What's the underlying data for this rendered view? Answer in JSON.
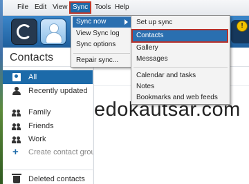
{
  "menubar": {
    "items": [
      "File",
      "Edit",
      "View",
      "Sync",
      "Tools",
      "Help"
    ],
    "active": "Sync"
  },
  "toolbar": {
    "warning_badge": "!"
  },
  "sidebar": {
    "title": "Contacts",
    "items": [
      {
        "label": "All",
        "icon": "all-contacts-icon",
        "selected": true
      },
      {
        "label": "Recently updated",
        "icon": "recent-icon"
      },
      {
        "label": "Family",
        "icon": "group-icon"
      },
      {
        "label": "Friends",
        "icon": "group-icon"
      },
      {
        "label": "Work",
        "icon": "group-icon"
      },
      {
        "label": "Create contact group",
        "icon": "plus-icon"
      },
      {
        "label": "Deleted contacts",
        "icon": "trash-icon"
      }
    ]
  },
  "sync_menu": {
    "items": [
      "Sync now",
      "View Sync log",
      "Sync options",
      "Repair sync..."
    ]
  },
  "sync_now_submenu": {
    "items": [
      "Set up sync",
      "Contacts",
      "Gallery",
      "Messages",
      "Calendar and tasks",
      "Notes",
      "Bookmarks and web feeds"
    ],
    "highlighted": "Contacts"
  },
  "watermark": "edokautsar.com",
  "colors": {
    "accent": "#1c6aa9",
    "highlight_outline": "#b8302a",
    "toolbar": "#2b73b8"
  }
}
